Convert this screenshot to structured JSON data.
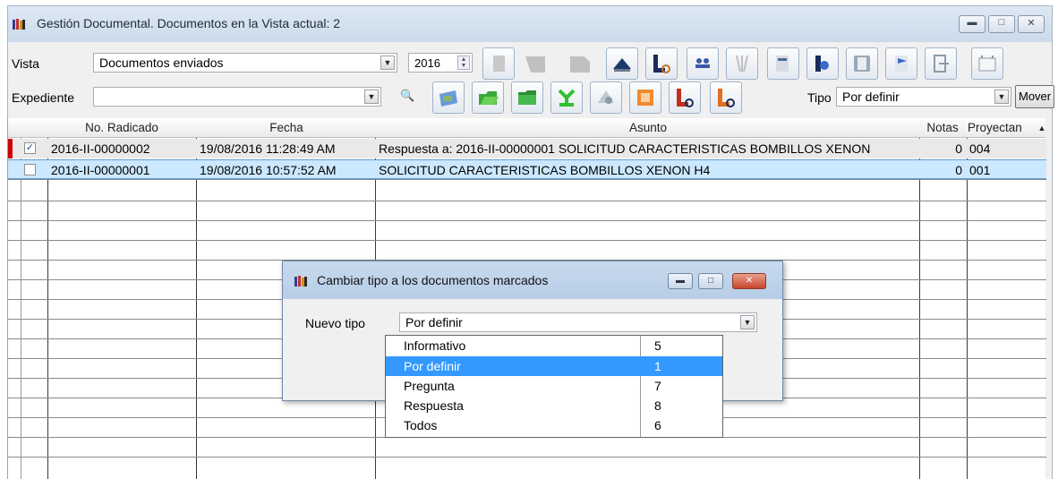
{
  "window": {
    "title": "Gestión Documental. Documentos en la Vista actual: 2",
    "caption_buttons": [
      "minimize",
      "restore",
      "close"
    ]
  },
  "toolbar": {
    "vista_label": "Vista",
    "vista_value": "Documentos enviados",
    "year_value": "2016",
    "expediente_label": "Expediente",
    "expediente_value": "",
    "tipo_label": "Tipo",
    "tipo_value": "Por definir",
    "mover_label": "Mover"
  },
  "grid": {
    "columns": [
      "No. Radicado",
      "Fecha",
      "Asunto",
      "Notas",
      "Proyectan"
    ],
    "rows": [
      {
        "checked": true,
        "radicado": "2016-II-00000002",
        "fecha": "19/08/2016 11:28:49 AM",
        "asunto": "Respuesta a: 2016-II-00000001 SOLICITUD CARACTERISTICAS BOMBILLOS XENON",
        "notas": "0",
        "proyectan": "004"
      },
      {
        "checked": false,
        "radicado": "2016-II-00000001",
        "fecha": "19/08/2016 10:57:52 AM",
        "asunto": "SOLICITUD CARACTERISTICAS BOMBILLOS XENON H4",
        "notas": "0",
        "proyectan": "001"
      }
    ]
  },
  "dialog": {
    "title": "Cambiar tipo a los documentos marcados",
    "nuevo_tipo_label": "Nuevo tipo",
    "nuevo_tipo_value": "Por definir",
    "options": [
      {
        "name": "Informativo",
        "value": "5"
      },
      {
        "name": "Por definir",
        "value": "1"
      },
      {
        "name": "Pregunta",
        "value": "7"
      },
      {
        "name": "Respuesta",
        "value": "8"
      },
      {
        "name": "Todos",
        "value": "6"
      }
    ],
    "selected_option": "Por definir"
  },
  "colors": {
    "selection": "#3399ff",
    "row_selected": "#cce8ff",
    "title_gradient": "#cbdaea",
    "marker_red": "#d00000"
  }
}
